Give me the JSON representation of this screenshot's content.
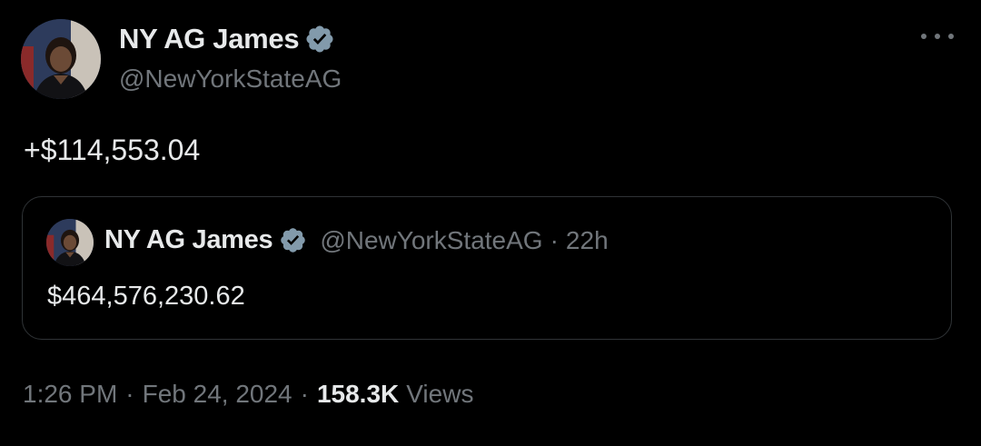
{
  "author": {
    "name": "NY AG James",
    "handle": "@NewYorkStateAG"
  },
  "tweet": {
    "text": "+$114,553.04"
  },
  "quoted": {
    "name": "NY AG James",
    "handle": "@NewYorkStateAG",
    "separator": "·",
    "time": "22h",
    "text": "$464,576,230.62"
  },
  "meta": {
    "time": "1:26 PM",
    "separator": "·",
    "date": "Feb 24, 2024",
    "views_count": "158.3K",
    "views_label": "Views"
  },
  "icons": {
    "verified": "verified-badge-icon",
    "more": "more-horizontal-icon"
  },
  "colors": {
    "background": "#000000",
    "text": "#e7e9ea",
    "secondary": "#71767b",
    "border": "#2f3336",
    "badge": "#829aab"
  }
}
